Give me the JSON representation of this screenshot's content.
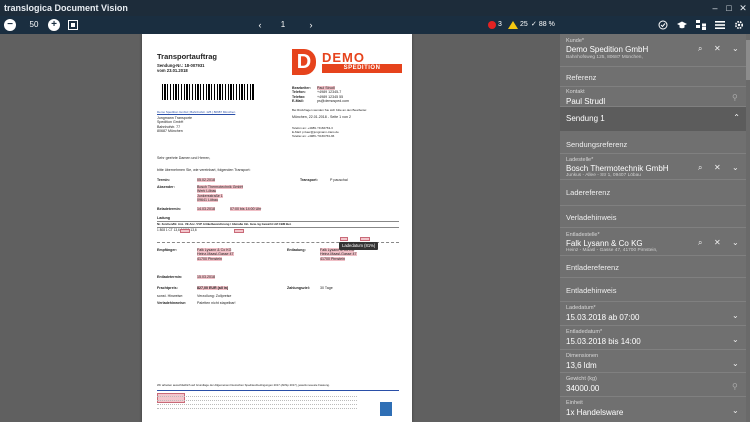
{
  "app": {
    "title": "translogica Document Vision"
  },
  "window_controls": {
    "minimize": "–",
    "maximize": "□",
    "close": "✕"
  },
  "toolbar": {
    "zoom_out": "−",
    "zoom_value": "50",
    "zoom_in": "+",
    "page_prev": "‹",
    "page_number": "1",
    "page_next": "›",
    "errors_count": "3",
    "warnings_count": "25",
    "confidence": "88 %"
  },
  "icons": {
    "fit": "fit-page-icon",
    "check": "check-circle-icon",
    "learn": "graduation-cap-icon",
    "structure": "structure-icon",
    "menu": "menu-icon",
    "settings": "gear-icon"
  },
  "document": {
    "title": "Transportauftrag",
    "sendung_nr": "Sendung-Nr.: 18-007931",
    "vom": "vom 23.01.2018",
    "logo_letter": "D",
    "logo_demo": "DEMO",
    "logo_spedition": "SPEDITION",
    "bearbeiter_label": "Bearbeiter:",
    "bearbeiter": "Paul Strudl",
    "telefon_label": "Telefon:",
    "telefon": "+4989 12345-7",
    "telefax_label": "Telefax:",
    "telefax": "+4989 12345 55",
    "email_label": "E-Mail:",
    "email": "ps@demosped.com",
    "rueckfrage": "Bei Rückfragen wenden Sie sich bitte an den Bearbeiter.",
    "datum_seite": "München, 22.01.2018  -  Seite 1 von 2",
    "addr_head": "Demo Spedition GmbH | Bahnhofstr. 125 | 80687 München",
    "addr1": "Jungmann Transporte",
    "addr2": "Spedition GmbH",
    "addr3": "Bahnhofstr. 77",
    "addr4": "80687 München",
    "tel_block1": "Telefon an:     +4989 / 5166763-3",
    "tel_block2": "E-Mail:          p.baer@jungmann-trans.de",
    "tel_block3": "Telefax an:     +4989 / 5166763-96",
    "greeting": "Sehr geehrte Damen und Herren,",
    "intro": "bitte übernehmen Sie, wie vereinbart, folgenden Transport:",
    "termin_label": "Termin:",
    "termin": "05.02.2018",
    "transport_label": "Transport:",
    "transport": "P pauschal",
    "absender_label": "Absender:",
    "absender1": "Bosch Thermotechnik GmbH",
    "absender2": "Werk Löbau",
    "absender3": "Junkersstraße 1",
    "absender4": "09641 Löbau",
    "beladetermin_label": "Beladetermin:",
    "beladetermin": "14.03.2018",
    "beladezeit": "07:00 bis 14:00 Uhr",
    "ladung_label": "Ladung",
    "tbl_headers": "Nr.  Zeichen/Nr.         Anz.  VE         Anz. VVP    Artikelbezeichnung / Abmaße              Inh. Gew. kg     Gewicht     LM      CBM     Bel.",
    "tbl_row": "1    808                   1     CT                                                                    13,6          34000      13,6",
    "empfaenger_label": "Empfänger:",
    "empfaenger1": "Falk Lysann & Co KG",
    "empfaenger2": "Heinz-Maasl-Gasse 47",
    "empfaenger3": "41700 Pirnstein",
    "entladung_label": "Entladung:",
    "entladung1": "Falk Lysann & Co KG",
    "entladung2": "Heinz-Maasl-Gasse 47",
    "entladung3": "41700 Pirnstein",
    "entladetermin_label": "Entladetermin:",
    "entladetermin": "15.03.2018",
    "frachtpreis_label": "Frachtpreis:",
    "frachtpreis": "827,00 EUR (all in)",
    "zahlungsziel_label": "Zahlungsziel:",
    "zahlungsziel": "30 Tage",
    "hinweise_label": "sonst. Hinweise:",
    "hinweise": "Verzollung: Zollpreise",
    "verlade_label": "Verladehinweise:",
    "verlade": "Paletten nicht stapelbar!",
    "footer_line": "Wir arbeiten ausschließlich auf Grundlage der Allgemeinen Deutschen Spediteurbedingungen 2017 (ADSp 2017), jeweils neueste Fassung.",
    "tooltip": "Ladedatum (81%)"
  },
  "panel": {
    "kunde_label": "Kunde*",
    "kunde_value": "Demo Spedition GmbH",
    "kunde_sub": "Bahnhofsweg 125, 80687 München,",
    "referenz": "Referenz",
    "kontakt_label": "Kontakt",
    "kontakt_value": "Paul Strudl",
    "sendung": "Sendung 1",
    "sendungsreferenz": "Sendungsreferenz",
    "ladestelle_label": "Ladestelle*",
    "ladestelle_value": "Bosch Thermotechnik GmbH",
    "ladestelle_sub": "Junkus - Allee - Str 1, 09407 Löbau",
    "ladereferenz": "Ladereferenz",
    "verladehinweis": "Verladehinweis",
    "entladestelle_label": "Entladestelle*",
    "entladestelle_value": "Falk Lysann & Co KG",
    "entladestelle_sub": "Heinz - Maasl - Gasse 47, 41700 Pirnstein,",
    "entladereferenz": "Entladereferenz",
    "entladehinweis": "Entladehinweis",
    "ladedatum_label": "Ladedatum*",
    "ladedatum_value": "15.03.2018 ab 07:00",
    "entladedatum_label": "Entladedatum*",
    "entladedatum_value": "15.03.2018 bis 14:00",
    "dimensionen_label": "Dimensionen",
    "dimensionen_value": "13,6 ldm",
    "gewicht_label": "Gewicht (kg)",
    "gewicht_value": "34000.00",
    "einheit_label": "Einheit",
    "einheit_value": "1x Handelsware",
    "chev_down": "⌄",
    "chev_up": "⌃",
    "search_glyph": "⌕",
    "clear_glyph": "✕",
    "pin_glyph": "⚲"
  }
}
